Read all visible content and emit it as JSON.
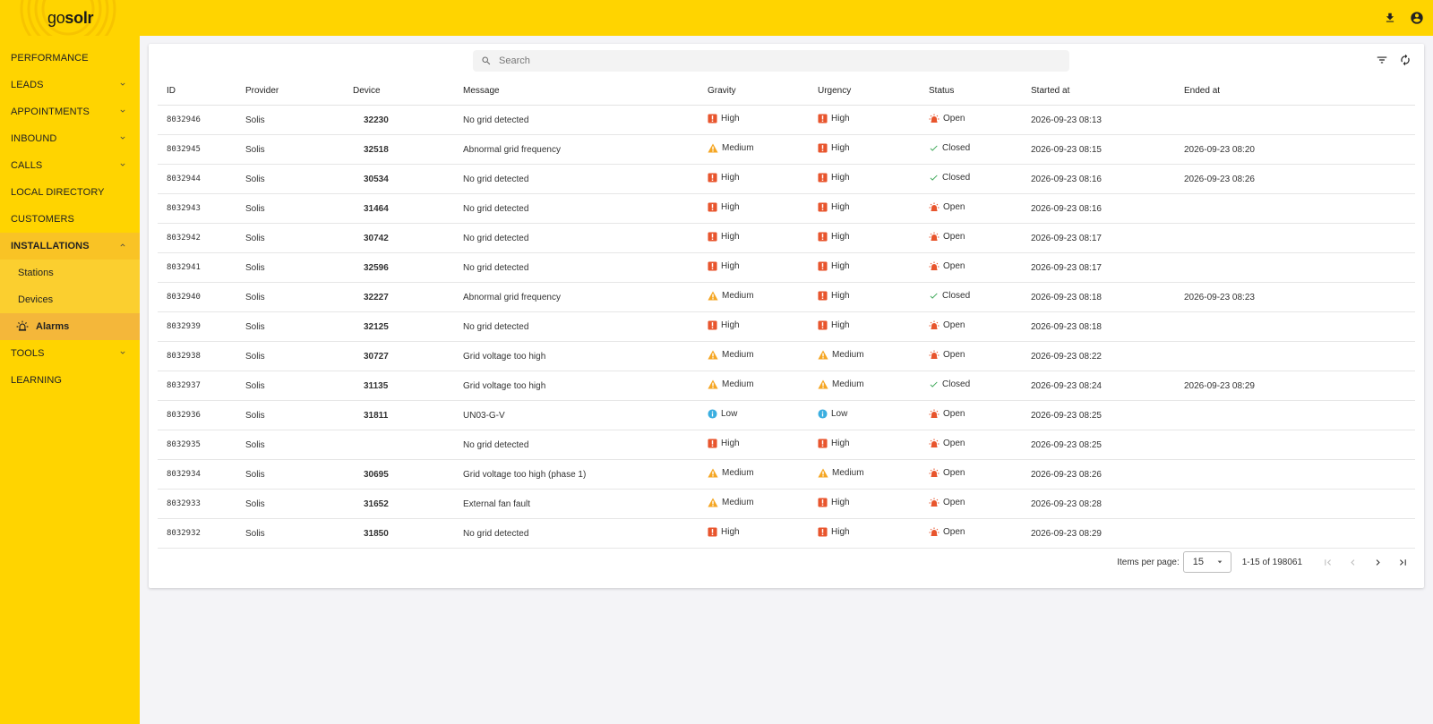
{
  "app": {
    "logo_prefix": "go",
    "logo_bold": "solr"
  },
  "topbar": {
    "download_icon": "download-icon",
    "account_icon": "account-circle-icon"
  },
  "sidebar": {
    "items": [
      {
        "label": "PERFORMANCE",
        "expandable": false
      },
      {
        "label": "LEADS",
        "expandable": true
      },
      {
        "label": "APPOINTMENTS",
        "expandable": true
      },
      {
        "label": "INBOUND",
        "expandable": true
      },
      {
        "label": "CALLS",
        "expandable": true
      },
      {
        "label": "LOCAL DIRECTORY",
        "expandable": false
      },
      {
        "label": "CUSTOMERS",
        "expandable": false
      },
      {
        "label": "INSTALLATIONS",
        "expandable": true,
        "expanded": true
      },
      {
        "label": "TOOLS",
        "expandable": true
      },
      {
        "label": "LEARNING",
        "expandable": false
      }
    ],
    "installations_children": [
      {
        "label": "Stations"
      },
      {
        "label": "Devices"
      },
      {
        "label": "Alarms",
        "selected": true
      }
    ]
  },
  "search": {
    "placeholder": "Search",
    "value": ""
  },
  "table": {
    "columns": [
      "ID",
      "Provider",
      "Device",
      "Message",
      "Gravity",
      "Urgency",
      "Status",
      "Started at",
      "Ended at"
    ],
    "rows": [
      {
        "id": "8032946",
        "provider": "Solis",
        "device": "32230",
        "message": "No grid detected",
        "gravity": "High",
        "urgency": "High",
        "status": "Open",
        "started": "2026-09-23 08:13",
        "ended": ""
      },
      {
        "id": "8032945",
        "provider": "Solis",
        "device": "32518",
        "message": "Abnormal grid frequency",
        "gravity": "Medium",
        "urgency": "High",
        "status": "Closed",
        "started": "2026-09-23 08:15",
        "ended": "2026-09-23 08:20"
      },
      {
        "id": "8032944",
        "provider": "Solis",
        "device": "30534",
        "message": "No grid detected",
        "gravity": "High",
        "urgency": "High",
        "status": "Closed",
        "started": "2026-09-23 08:16",
        "ended": "2026-09-23 08:26"
      },
      {
        "id": "8032943",
        "provider": "Solis",
        "device": "31464",
        "message": "No grid detected",
        "gravity": "High",
        "urgency": "High",
        "status": "Open",
        "started": "2026-09-23 08:16",
        "ended": ""
      },
      {
        "id": "8032942",
        "provider": "Solis",
        "device": "30742",
        "message": "No grid detected",
        "gravity": "High",
        "urgency": "High",
        "status": "Open",
        "started": "2026-09-23 08:17",
        "ended": ""
      },
      {
        "id": "8032941",
        "provider": "Solis",
        "device": "32596",
        "message": "No grid detected",
        "gravity": "High",
        "urgency": "High",
        "status": "Open",
        "started": "2026-09-23 08:17",
        "ended": ""
      },
      {
        "id": "8032940",
        "provider": "Solis",
        "device": "32227",
        "message": "Abnormal grid frequency",
        "gravity": "Medium",
        "urgency": "High",
        "status": "Closed",
        "started": "2026-09-23 08:18",
        "ended": "2026-09-23 08:23"
      },
      {
        "id": "8032939",
        "provider": "Solis",
        "device": "32125",
        "message": "No grid detected",
        "gravity": "High",
        "urgency": "High",
        "status": "Open",
        "started": "2026-09-23 08:18",
        "ended": ""
      },
      {
        "id": "8032938",
        "provider": "Solis",
        "device": "30727",
        "message": "Grid voltage too high",
        "gravity": "Medium",
        "urgency": "Medium",
        "status": "Open",
        "started": "2026-09-23 08:22",
        "ended": ""
      },
      {
        "id": "8032937",
        "provider": "Solis",
        "device": "31135",
        "message": "Grid voltage too high",
        "gravity": "Medium",
        "urgency": "Medium",
        "status": "Closed",
        "started": "2026-09-23 08:24",
        "ended": "2026-09-23 08:29"
      },
      {
        "id": "8032936",
        "provider": "Solis",
        "device": "31811",
        "message": "UN03-G-V",
        "gravity": "Low",
        "urgency": "Low",
        "status": "Open",
        "started": "2026-09-23 08:25",
        "ended": ""
      },
      {
        "id": "8032935",
        "provider": "Solis",
        "device": "",
        "message": "No grid detected",
        "gravity": "High",
        "urgency": "High",
        "status": "Open",
        "started": "2026-09-23 08:25",
        "ended": ""
      },
      {
        "id": "8032934",
        "provider": "Solis",
        "device": "30695",
        "message": "Grid voltage too high (phase 1)",
        "gravity": "Medium",
        "urgency": "Medium",
        "status": "Open",
        "started": "2026-09-23 08:26",
        "ended": ""
      },
      {
        "id": "8032933",
        "provider": "Solis",
        "device": "31652",
        "message": "External fan fault",
        "gravity": "Medium",
        "urgency": "High",
        "status": "Open",
        "started": "2026-09-23 08:28",
        "ended": ""
      },
      {
        "id": "8032932",
        "provider": "Solis",
        "device": "31850",
        "message": "No grid detected",
        "gravity": "High",
        "urgency": "High",
        "status": "Open",
        "started": "2026-09-23 08:29",
        "ended": ""
      }
    ]
  },
  "pagination": {
    "items_per_page_label": "Items per page:",
    "items_per_page": "15",
    "range": "1-15 of 198061"
  },
  "colors": {
    "brand_yellow": "#ffd400",
    "high": "#e8552d",
    "medium": "#f5a623",
    "low": "#3aaee0",
    "open": "#e8552d",
    "closed": "#3aa655"
  }
}
